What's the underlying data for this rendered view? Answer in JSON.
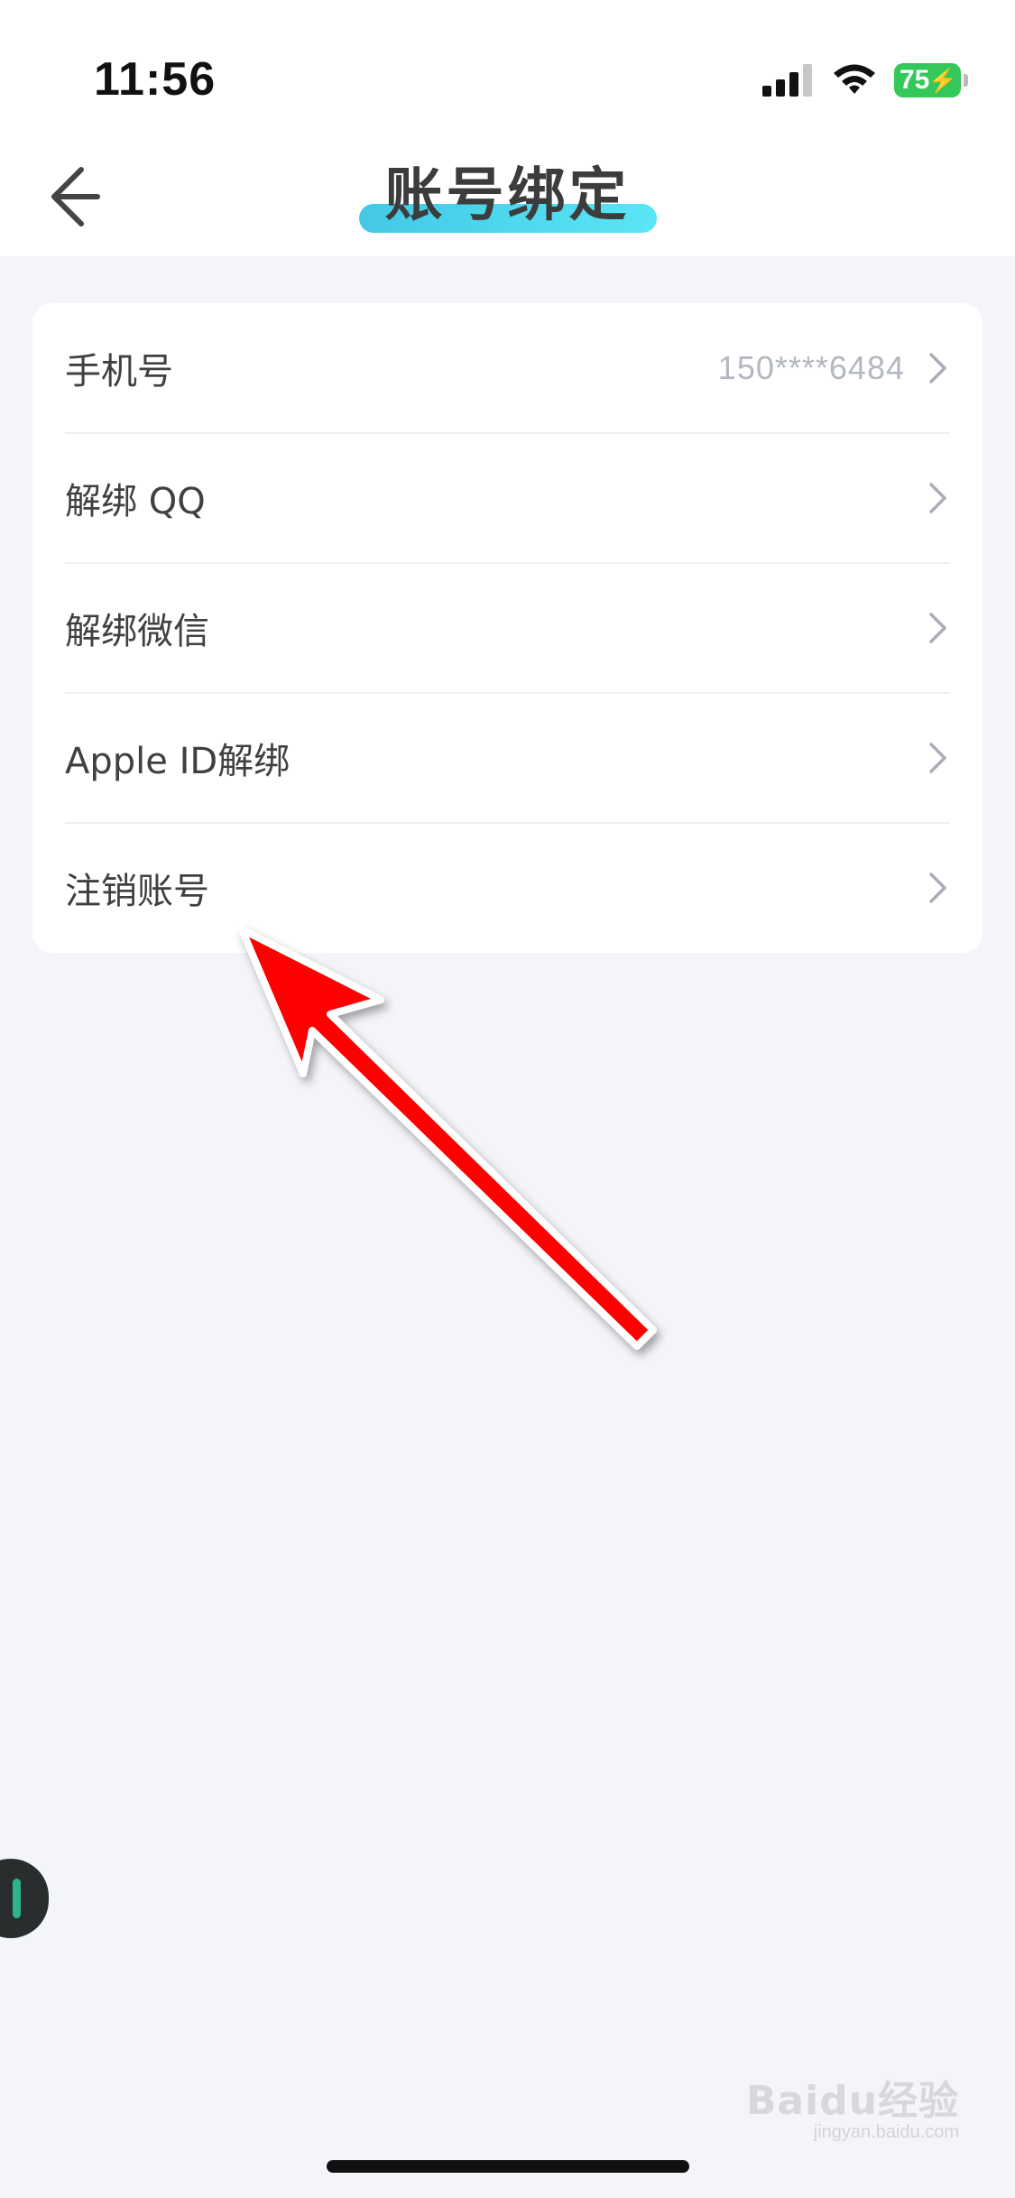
{
  "status_bar": {
    "time": "11:56",
    "battery": "75",
    "signal_icon": "signal-bars-icon",
    "wifi_icon": "wifi-icon",
    "battery_icon": "battery-charging-icon"
  },
  "nav": {
    "title": "账号绑定",
    "back_icon": "back-arrow-icon",
    "title_accent": "#4fd4ee"
  },
  "rows": [
    {
      "label": "手机号",
      "value": "150****6484"
    },
    {
      "label": "解绑 QQ",
      "value": ""
    },
    {
      "label": "解绑微信",
      "value": ""
    },
    {
      "label": "Apple ID解绑",
      "value": ""
    },
    {
      "label": "注销账号",
      "value": ""
    }
  ],
  "annotation": {
    "arrow_color": "#ff0000",
    "points_to": "注销账号"
  },
  "watermark": {
    "main": "Baidu经验",
    "sub": "jingyan.baidu.com"
  }
}
